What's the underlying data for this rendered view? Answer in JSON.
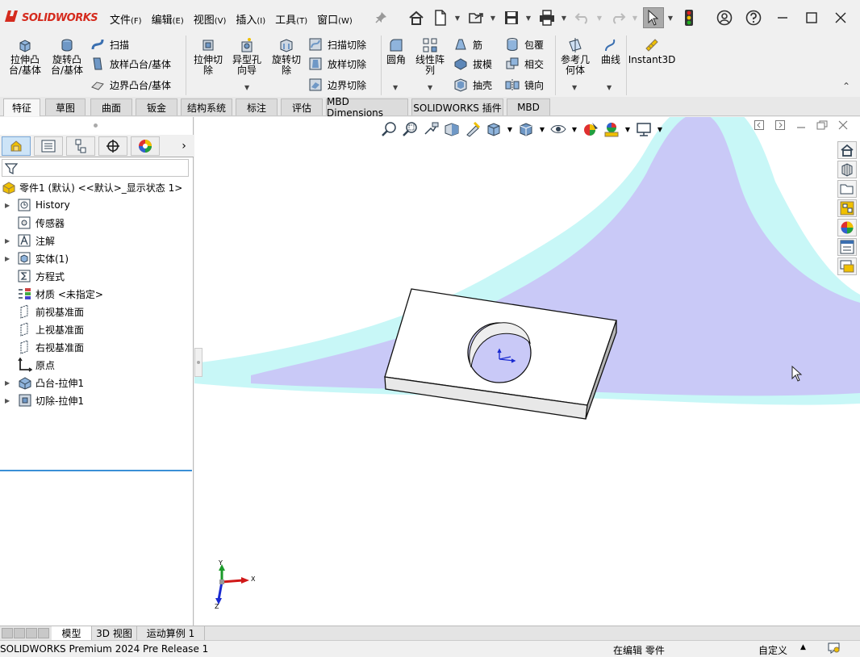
{
  "app": {
    "logo_text": "SOLIDWORKS"
  },
  "menu": [
    {
      "label": "文件",
      "accel": "(F)"
    },
    {
      "label": "编辑",
      "accel": "(E)"
    },
    {
      "label": "视图",
      "accel": "(V)"
    },
    {
      "label": "插入",
      "accel": "(I)"
    },
    {
      "label": "工具",
      "accel": "(T)"
    },
    {
      "label": "窗口",
      "accel": "(W)"
    }
  ],
  "ribbon": {
    "extrude_boss": "拉伸凸\n台/基体",
    "revolve_boss": "旋转凸\n台/基体",
    "sweep": "扫描",
    "loft": "放样凸台/基体",
    "boundary_boss": "边界凸台/基体",
    "extrude_cut": "拉伸切\n除",
    "hole_wizard": "异型孔\n向导",
    "revolve_cut": "旋转切\n除",
    "swept_cut": "扫描切除",
    "lofted_cut": "放样切除",
    "boundary_cut": "边界切除",
    "fillet": "圆角",
    "linear_pattern": "线性阵\n列",
    "rib": "筋",
    "draft": "拔模",
    "shell": "抽壳",
    "wrap": "包覆",
    "intersect": "相交",
    "mirror": "镜向",
    "ref_geometry": "参考几\n何体",
    "curves": "曲线",
    "instant3d": "Instant3D"
  },
  "command_tabs": [
    "特征",
    "草图",
    "曲面",
    "钣金",
    "结构系统",
    "标注",
    "评估",
    "MBD Dimensions",
    "SOLIDWORKS 插件",
    "MBD"
  ],
  "active_command_tab": "特征",
  "tree": {
    "root": "零件1 (默认) <<默认>_显示状态 1>",
    "items": [
      {
        "label": "History",
        "expandable": true,
        "icon": "history-icon"
      },
      {
        "label": "传感器",
        "expandable": false,
        "icon": "sensor-icon"
      },
      {
        "label": "注解",
        "expandable": true,
        "icon": "annotation-icon"
      },
      {
        "label": "实体(1)",
        "expandable": true,
        "icon": "solid-body-icon"
      },
      {
        "label": "方程式",
        "expandable": false,
        "icon": "equation-icon"
      },
      {
        "label": "材质 <未指定>",
        "expandable": false,
        "icon": "material-icon"
      },
      {
        "label": "前视基准面",
        "expandable": false,
        "icon": "plane-icon"
      },
      {
        "label": "上视基准面",
        "expandable": false,
        "icon": "plane-icon"
      },
      {
        "label": "右视基准面",
        "expandable": false,
        "icon": "plane-icon"
      },
      {
        "label": "原点",
        "expandable": false,
        "icon": "origin-icon"
      },
      {
        "label": "凸台-拉伸1",
        "expandable": true,
        "icon": "boss-extrude-icon"
      },
      {
        "label": "切除-拉伸1",
        "expandable": true,
        "icon": "cut-extrude-icon"
      }
    ]
  },
  "triad": {
    "x": "X",
    "y": "Y",
    "z": "Z"
  },
  "bottom_tabs": [
    "模型",
    "3D 视图",
    "运动算例 1"
  ],
  "active_bottom_tab": "模型",
  "status": {
    "product": "SOLIDWORKS Premium 2024 Pre Release 1",
    "mode": "在编辑 零件",
    "units": "自定义"
  },
  "colors": {
    "accent_red": "#d52b1e",
    "viewport_cyan": "#c8f7f7",
    "viewport_lavender": "#c9c9f7",
    "tree_selection_line": "#3a8fd6"
  }
}
